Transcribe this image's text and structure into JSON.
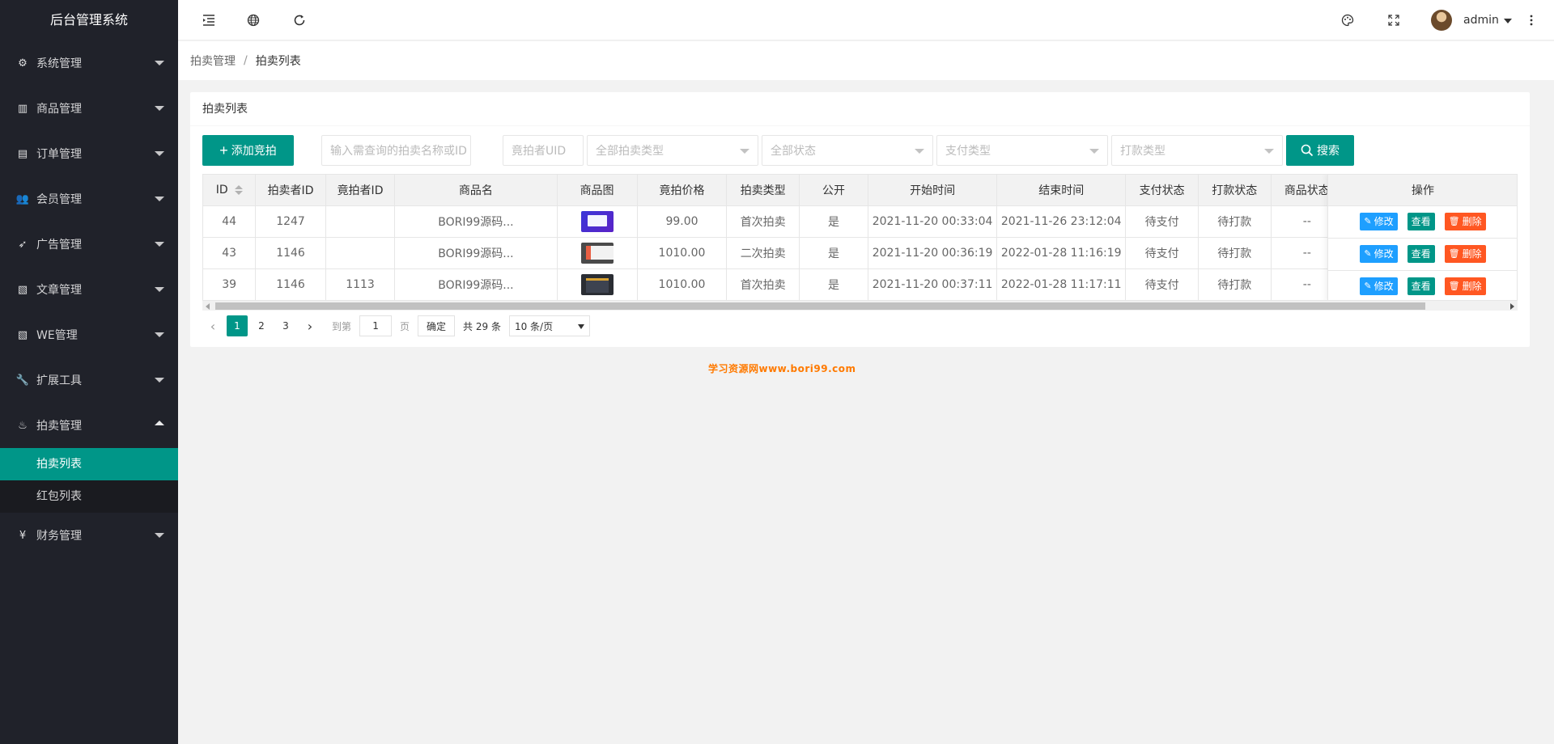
{
  "app": {
    "title": "后台管理系统"
  },
  "sidebar": {
    "items": [
      {
        "label": "系统管理",
        "icon": "gear-icon"
      },
      {
        "label": "商品管理",
        "icon": "bar-chart-icon"
      },
      {
        "label": "订单管理",
        "icon": "calendar-icon"
      },
      {
        "label": "会员管理",
        "icon": "users-icon"
      },
      {
        "label": "广告管理",
        "icon": "rocket-icon"
      },
      {
        "label": "文章管理",
        "icon": "document-icon"
      },
      {
        "label": "WE管理",
        "icon": "document-icon"
      },
      {
        "label": "扩展工具",
        "icon": "wrench-icon"
      },
      {
        "label": "拍卖管理",
        "icon": "fire-icon",
        "expanded": true,
        "children": [
          {
            "label": "拍卖列表",
            "active": true
          },
          {
            "label": "红包列表"
          }
        ]
      },
      {
        "label": "财务管理",
        "icon": "yen-icon"
      }
    ]
  },
  "header": {
    "username": "admin"
  },
  "breadcrumb": {
    "parent": "拍卖管理",
    "separator": "/",
    "current": "拍卖列表"
  },
  "card": {
    "title": "拍卖列表"
  },
  "toolbar": {
    "add_label": "添加竞拍",
    "search_label": "搜索",
    "name_placeholder": "输入需查询的拍卖名称或ID",
    "uid_placeholder": "竟拍者UID",
    "type_select": "全部拍卖类型",
    "status_select": "全部状态",
    "pay_select": "支付类型",
    "payout_select": "打款类型"
  },
  "table": {
    "headers": [
      "ID",
      "拍卖者ID",
      "竟拍者ID",
      "商品名",
      "商品图",
      "竟拍价格",
      "拍卖类型",
      "公开",
      "开始时间",
      "结束时间",
      "支付状态",
      "打款状态",
      "商品状态",
      "操作"
    ],
    "rows": [
      {
        "id": "44",
        "seller": "1247",
        "bidder": "",
        "name": "BORI99源码...",
        "price": "99.00",
        "type": "首次拍卖",
        "public": "是",
        "start": "2021-11-20 00:33:04",
        "end": "2021-11-26 23:12:04",
        "pay": "待支付",
        "payout": "待打款",
        "goods": "--"
      },
      {
        "id": "43",
        "seller": "1146",
        "bidder": "",
        "name": "BORI99源码...",
        "price": "1010.00",
        "type": "二次拍卖",
        "public": "是",
        "start": "2021-11-20 00:36:19",
        "end": "2022-01-28 11:16:19",
        "pay": "待支付",
        "payout": "待打款",
        "goods": "--"
      },
      {
        "id": "39",
        "seller": "1146",
        "bidder": "1113",
        "name": "BORI99源码...",
        "price": "1010.00",
        "type": "首次拍卖",
        "public": "是",
        "start": "2021-11-20 00:37:11",
        "end": "2022-01-28 11:17:11",
        "pay": "待支付",
        "payout": "待打款",
        "goods": "--"
      }
    ],
    "actions": {
      "edit": "修改",
      "view": "查看",
      "delete": "删除"
    }
  },
  "pager": {
    "pages": [
      "1",
      "2",
      "3"
    ],
    "current": "1",
    "goto_prefix": "到第",
    "goto_value": "1",
    "goto_suffix": "页",
    "confirm": "确定",
    "total": "共 29 条",
    "limit": "10 条/页"
  },
  "watermark": "学习资源网www.bori99.com"
}
